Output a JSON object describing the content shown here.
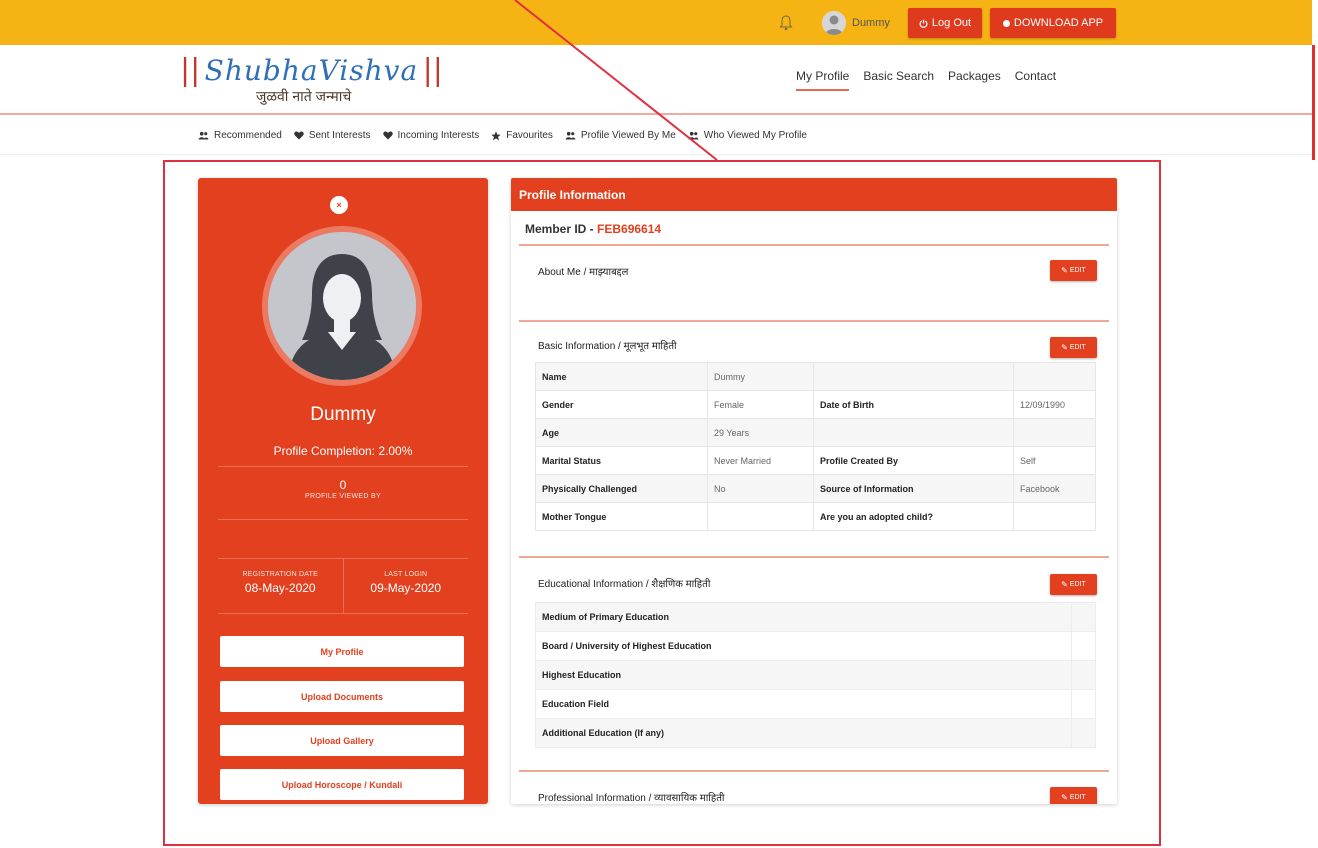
{
  "topbar": {
    "user_name": "Dummy",
    "logout_label": "Log Out",
    "download_label": "DOWNLOAD APP",
    "colors": {
      "bar": "#f5b414",
      "button": "#e03a1e"
    }
  },
  "header": {
    "logo_bars_left": "||",
    "logo_word": "ShubhaVishva",
    "logo_bars_right": "||",
    "tagline": "जुळवी नाते जन्माचे",
    "nav": [
      "My Profile",
      "Basic Search",
      "Packages",
      "Contact"
    ]
  },
  "subnav": [
    {
      "icon": "users-icon",
      "label": "Recommended"
    },
    {
      "icon": "heart-icon",
      "label": "Sent Interests"
    },
    {
      "icon": "heart-icon",
      "label": "Incoming Interests"
    },
    {
      "icon": "star-icon",
      "label": "Favourites"
    },
    {
      "icon": "users-icon",
      "label": "Profile Viewed By Me"
    },
    {
      "icon": "users-icon",
      "label": "Who Viewed My Profile"
    }
  ],
  "profile_card": {
    "name": "Dummy",
    "completion": "Profile Completion: 2.00%",
    "views_count": "0",
    "views_label": "PROFILE VIEWED BY",
    "registration_label": "REGISTRATION DATE",
    "registration_date": "08-May-2020",
    "last_login_label": "LAST LOGIN",
    "last_login_date": "09-May-2020",
    "buttons": [
      "My Profile",
      "Upload Documents",
      "Upload Gallery",
      "Upload Horoscope / Kundali"
    ]
  },
  "info": {
    "header": "Profile Information",
    "member_id_label": "Member ID - ",
    "member_id": "FEB696614",
    "edit_label": "EDIT",
    "about_title": "About Me / माझ्याबद्दल",
    "basic_title": "Basic Information / मूलभूत माहिती",
    "basic_rows": [
      [
        "Name",
        "Dummy",
        "",
        ""
      ],
      [
        "Gender",
        "Female",
        "Date of Birth",
        "12/09/1990"
      ],
      [
        "Age",
        "29 Years",
        "",
        ""
      ],
      [
        "Marital Status",
        "Never Married",
        "Profile Created By",
        "Self"
      ],
      [
        "Physically Challenged",
        "No",
        "Source of Information",
        "Facebook"
      ],
      [
        "Mother Tongue",
        "",
        "Are you an adopted child?",
        ""
      ]
    ],
    "edu_title": "Educational Information / शैक्षणिक माहिती",
    "edu_rows": [
      "Medium of Primary Education",
      "Board / University of Highest Education",
      "Highest Education",
      "Education Field",
      "Additional Education (If any)"
    ],
    "prof_title": "Professional Information / व्यावसायिक माहिती"
  }
}
